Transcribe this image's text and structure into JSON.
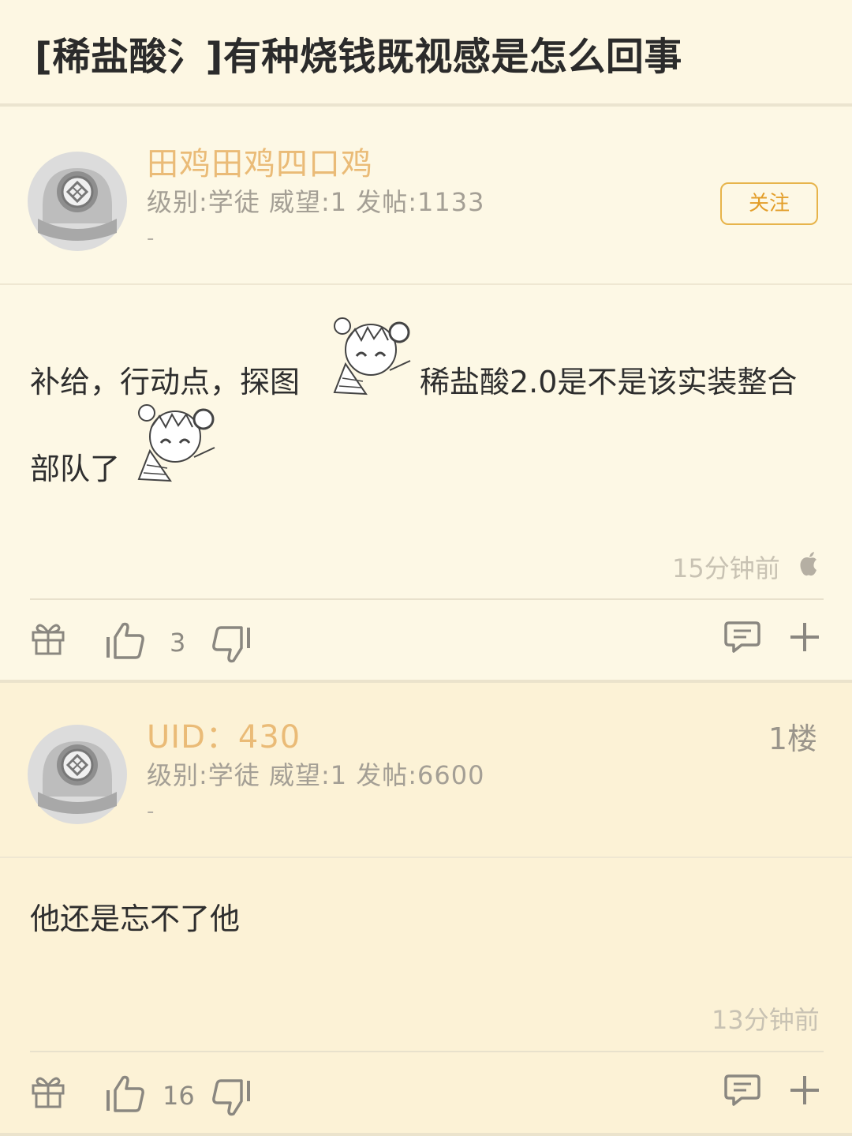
{
  "title": "[稀盐酸氵]有种烧钱既视感是怎么回事",
  "posts": [
    {
      "username": "田鸡田鸡四口鸡",
      "stats": "级别:学徒 威望:1 发帖:1133",
      "dash": "-",
      "follow_label": "关注",
      "content": {
        "line1_a": "补给，行动点，探图",
        "line1_b": "稀盐酸2.0是不是该实装整合",
        "line2": "部队了"
      },
      "time": "15分钟前",
      "device_icon": "apple-icon",
      "likes": "3"
    },
    {
      "username": "UID：430",
      "stats": "级别:学徒 威望:1 发帖:6600",
      "dash": "-",
      "floor": "1楼",
      "content": {
        "line1": "他还是忘不了他"
      },
      "time": "13分钟前",
      "likes": "16"
    }
  ],
  "icons": {
    "gift": "gift-icon",
    "like": "thumbs-up-icon",
    "dislike": "thumbs-down-icon",
    "reply": "comment-icon",
    "more": "plus-icon"
  },
  "colors": {
    "background": "#fdf7e3",
    "username": "#eabb77",
    "follow": "#e39e2a",
    "text": "#2e2e2e"
  }
}
